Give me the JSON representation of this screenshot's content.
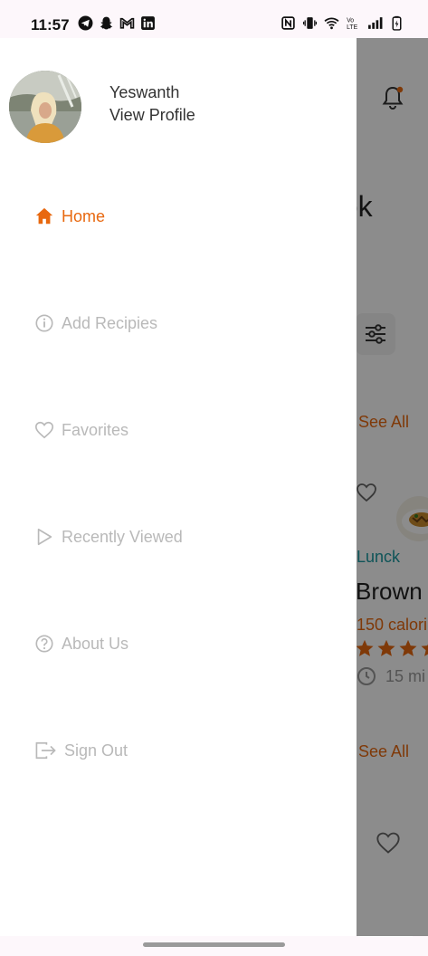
{
  "status_bar": {
    "time": "11:57"
  },
  "drawer": {
    "user": {
      "name": "Yeswanth",
      "profile_link": "View Profile"
    },
    "items": [
      {
        "label": "Home",
        "icon": "home-icon",
        "active": true
      },
      {
        "label": "Add Recipies",
        "icon": "info-icon",
        "active": false
      },
      {
        "label": "Favorites",
        "icon": "heart-icon",
        "active": false
      },
      {
        "label": "Recently Viewed",
        "icon": "play-icon",
        "active": false
      },
      {
        "label": "About Us",
        "icon": "help-icon",
        "active": false
      },
      {
        "label": "Sign Out",
        "icon": "sign-out-icon",
        "active": false
      }
    ]
  },
  "background_screen": {
    "title_fragment": "ook",
    "see_all_1": "See All",
    "category": "Lunck",
    "recipe_name_fragment": "Brown",
    "calories_fragment": "150 calori",
    "time_fragment": "15 mi",
    "see_all_2": "See All"
  },
  "colors": {
    "accent": "#e8680f",
    "inactive": "#b9b9b9",
    "category": "#1a9aa0"
  }
}
